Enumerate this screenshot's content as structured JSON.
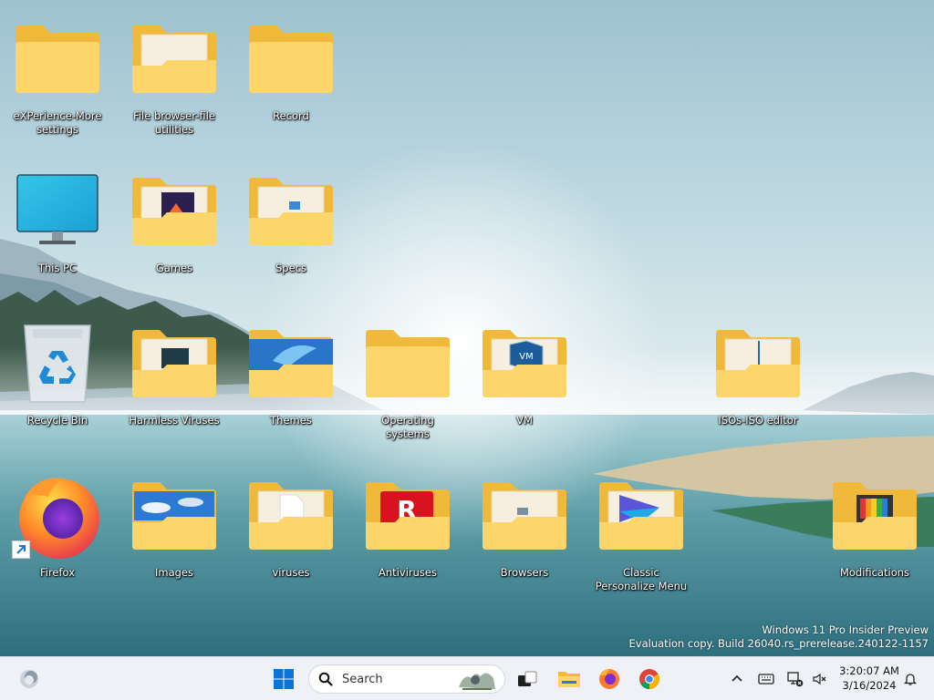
{
  "desktop": {
    "icons": [
      {
        "label": "eXPerience-More settings",
        "type": "folder"
      },
      {
        "label": "File browser-file utilities",
        "type": "folder"
      },
      {
        "label": "Record",
        "type": "folder"
      },
      {
        "label": "This PC",
        "type": "this-pc"
      },
      {
        "label": "Games",
        "type": "folder"
      },
      {
        "label": "Specs",
        "type": "folder"
      },
      {
        "label": "Recycle Bin",
        "type": "recycle-bin"
      },
      {
        "label": "Harmless Viruses",
        "type": "folder"
      },
      {
        "label": "Themes",
        "type": "folder"
      },
      {
        "label": "Operating systems",
        "type": "folder"
      },
      {
        "label": "VM",
        "type": "folder"
      },
      {
        "label": "ISOs-ISO editor",
        "type": "folder"
      },
      {
        "label": "Firefox",
        "type": "firefox-shortcut"
      },
      {
        "label": "Images",
        "type": "folder"
      },
      {
        "label": "viruses",
        "type": "folder"
      },
      {
        "label": "Antiviruses",
        "type": "folder"
      },
      {
        "label": "Browsers",
        "type": "folder"
      },
      {
        "label": "Classic Personalize Menu",
        "type": "folder"
      },
      {
        "label": "Modifications",
        "type": "folder"
      }
    ]
  },
  "watermark": {
    "line1": "Windows 11 Pro Insider Preview",
    "line2": "Evaluation copy. Build 26040.rs_prerelease.240122-1157"
  },
  "taskbar": {
    "search_label": "Search",
    "apps": [
      "widgets-icon",
      "start-icon",
      "task-view-icon",
      "file-explorer-icon",
      "firefox-icon",
      "chrome-icon"
    ],
    "clock": {
      "time": "3:20:07 AM",
      "date": "3/16/2024"
    }
  },
  "colors": {
    "folder_back": "#f0b93a",
    "folder_front": "#fcd66a",
    "taskbar_bg": "#eef2f6",
    "windows_blue": "#0a74d8"
  }
}
